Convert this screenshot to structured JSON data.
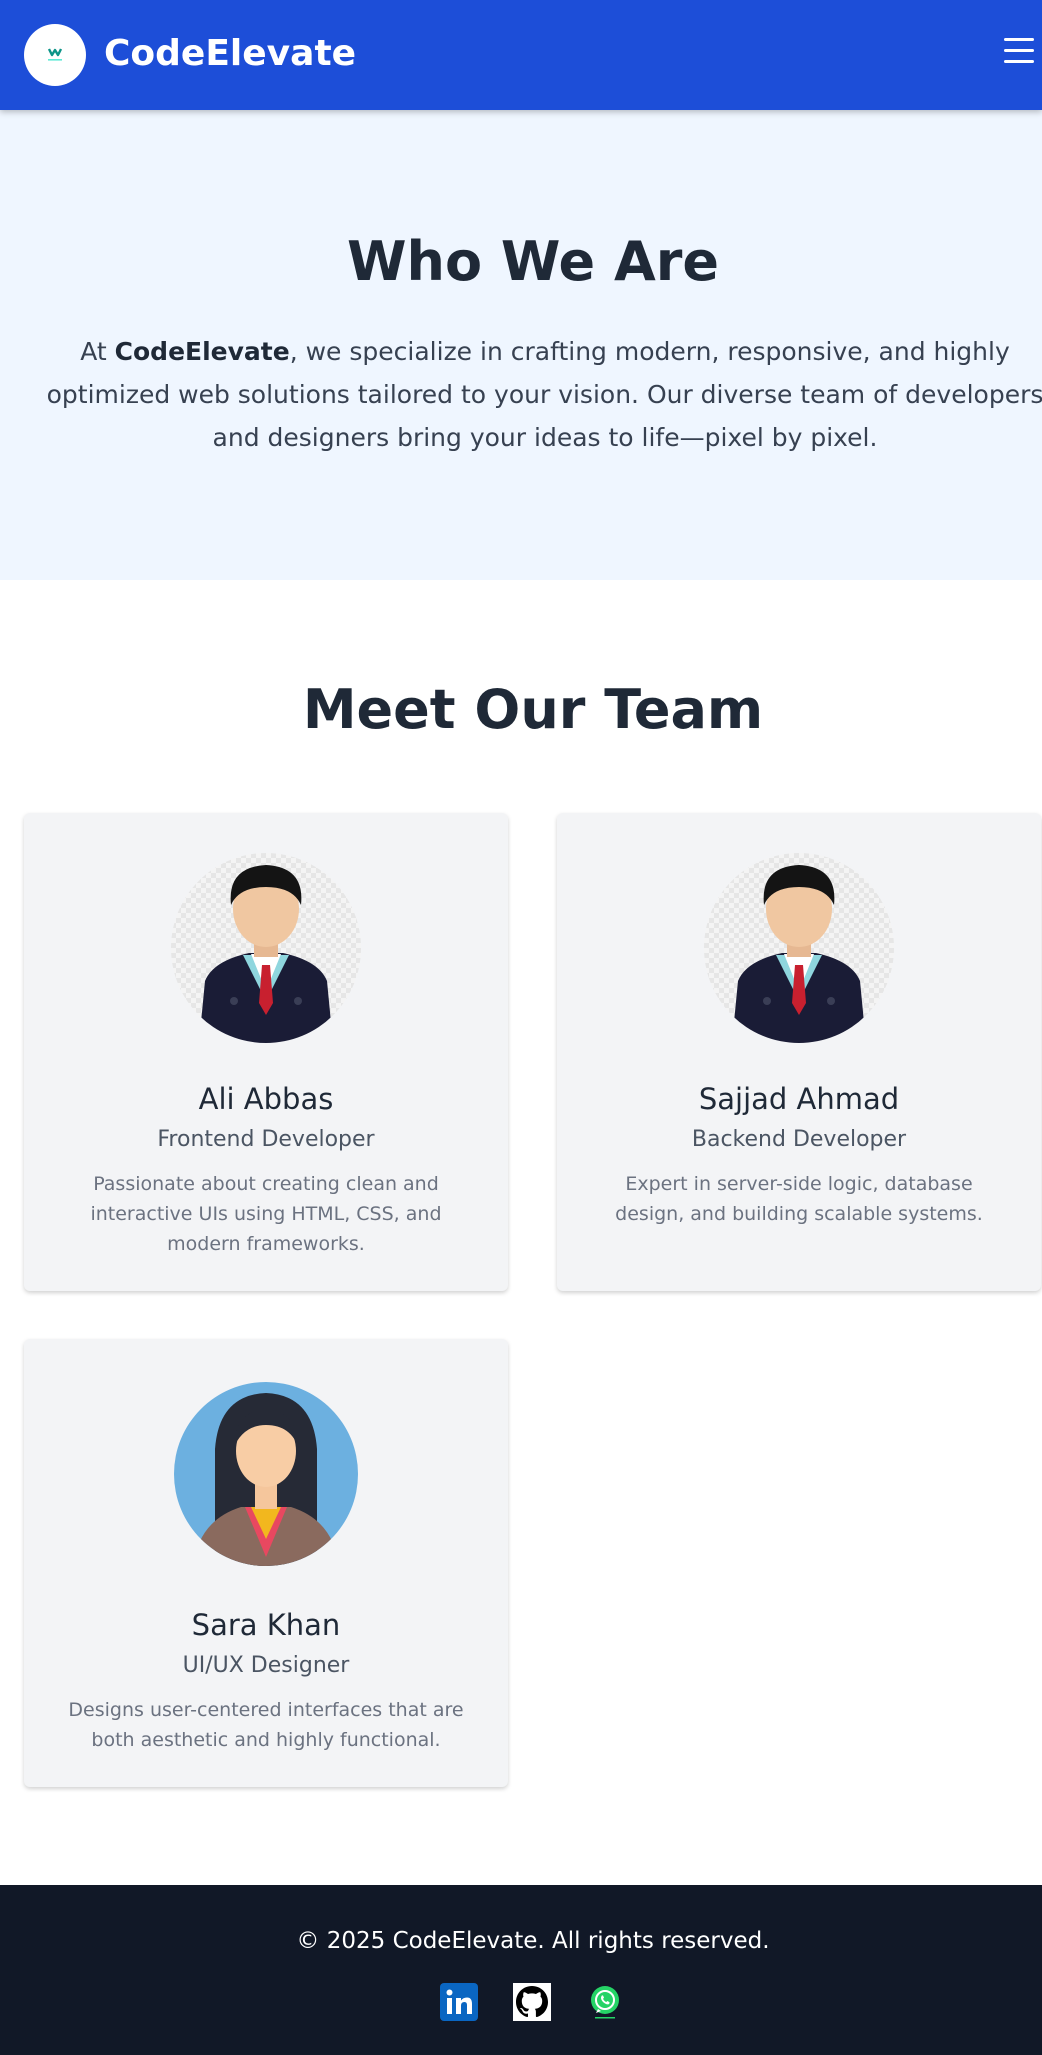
{
  "header": {
    "brand": "CodeElevate",
    "logo_icon": "logo-icon",
    "menu_icon": "hamburger-menu-icon",
    "color": "#1d4ed8"
  },
  "about": {
    "title": "Who We Are",
    "text_prefix": "At ",
    "text_brand": "CodeElevate",
    "text_rest": ", we specialize in crafting modern, responsive, and highly optimized web solutions tailored to your vision. Our diverse team of developers and designers bring your ideas to life—pixel by pixel."
  },
  "team": {
    "title": "Meet Our Team",
    "members": [
      {
        "name": "Ali Abbas",
        "role": "Frontend Developer",
        "desc": "Passionate about creating clean and interactive UIs using HTML, CSS, and modern frameworks.",
        "avatar_icon": "male-avatar-icon"
      },
      {
        "name": "Sajjad Ahmad",
        "role": "Backend Developer",
        "desc": "Expert in server-side logic, database design, and building scalable systems.",
        "avatar_icon": "male-avatar-icon"
      },
      {
        "name": "Sara Khan",
        "role": "UI/UX Designer",
        "desc": "Designs user-centered interfaces that are both aesthetic and highly functional.",
        "avatar_icon": "female-avatar-icon"
      }
    ]
  },
  "footer": {
    "text": "© 2025 CodeElevate. All rights reserved.",
    "social_icons": [
      "linkedin-icon",
      "github-icon",
      "whatsapp-icon"
    ]
  }
}
